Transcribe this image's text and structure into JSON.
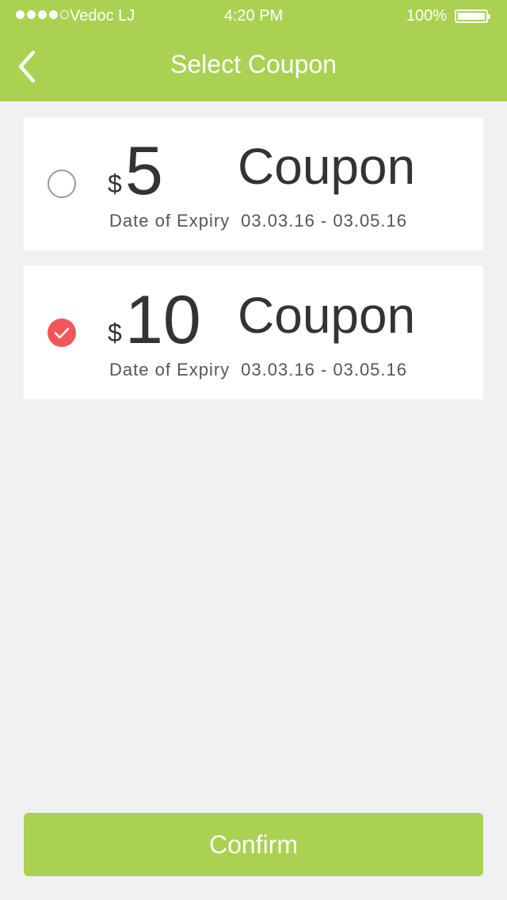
{
  "status_bar": {
    "carrier": "Vedoc LJ",
    "time": "4:20 PM",
    "battery": "100%",
    "battery_level": 1.0,
    "signal_bars_filled": 4,
    "signal_bars_total": 5
  },
  "nav": {
    "title": "Select Coupon",
    "back_icon": "chevron-left-icon"
  },
  "coupons": [
    {
      "currency": "$",
      "amount": "5",
      "label": "Coupon",
      "expiry_label": "Date of Expiry",
      "expiry_range": "03.03.16 - 03.05.16",
      "selected": false
    },
    {
      "currency": "$",
      "amount": "10",
      "label": "Coupon",
      "expiry_label": "Date of Expiry",
      "expiry_range": "03.03.16 - 03.05.16",
      "selected": true
    }
  ],
  "confirm": {
    "label": "Confirm"
  },
  "colors": {
    "accent": "#aad152",
    "selected": "#f2565a",
    "background": "#f1f1f1",
    "card": "#ffffff",
    "text": "#333333"
  }
}
